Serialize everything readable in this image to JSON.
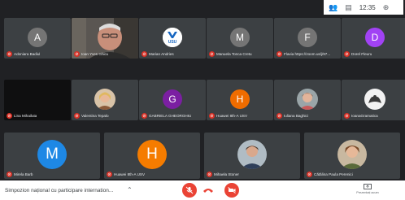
{
  "header": {
    "clock": "12:35"
  },
  "tiles": [
    {
      "name": "Adoniara Badiul",
      "initial": "A",
      "color": "#757575",
      "kind": "avatar"
    },
    {
      "name": "Ioan Yves Ghicu",
      "kind": "video"
    },
    {
      "name": "Marian Andries",
      "kind": "usu"
    },
    {
      "name": "Manuela Tonca Cretu",
      "initial": "M",
      "color": "#757575",
      "kind": "avatar"
    },
    {
      "name": "Flavia https://zoom.us/j/97...",
      "initial": "F",
      "color": "#757575",
      "kind": "avatar"
    },
    {
      "name": "Dorel Fleuru",
      "initial": "D",
      "color": "#a142f4",
      "kind": "avatar"
    },
    {
      "name": "Lina Mihailuta",
      "kind": "dark"
    },
    {
      "name": "Valentina Tepalo",
      "kind": "photo"
    },
    {
      "name": "GABRIELA GHEORGHIU",
      "initial": "G",
      "color": "#7b1fa2",
      "kind": "avatar"
    },
    {
      "name": "Huawei 8th-A USV",
      "initial": "H",
      "color": "#ef6c00",
      "kind": "avatar"
    },
    {
      "name": "Iuliana Baghici",
      "kind": "photo"
    },
    {
      "name": "IoanaGramatica",
      "kind": "photo"
    },
    {
      "name": "Mirela Barb",
      "initial": "M",
      "color": "#1e88e5",
      "kind": "avatar-lg"
    },
    {
      "name": "Huawei 8th-A USV",
      "initial": "H",
      "color": "#f57c00",
      "kind": "avatar-lg"
    },
    {
      "name": "Mihaela Stoner",
      "kind": "photo-lg"
    },
    {
      "name": "Cătălina Paula Perenici",
      "kind": "photo-lg"
    }
  ],
  "footer": {
    "meeting_title": "Simpozion național cu participare internation...",
    "present_label": "Prezentați acum",
    "usu_logo_text": "USU"
  },
  "colors": {
    "end_call": "#ea4335",
    "stage": "#202124",
    "tile": "#3c4043"
  }
}
